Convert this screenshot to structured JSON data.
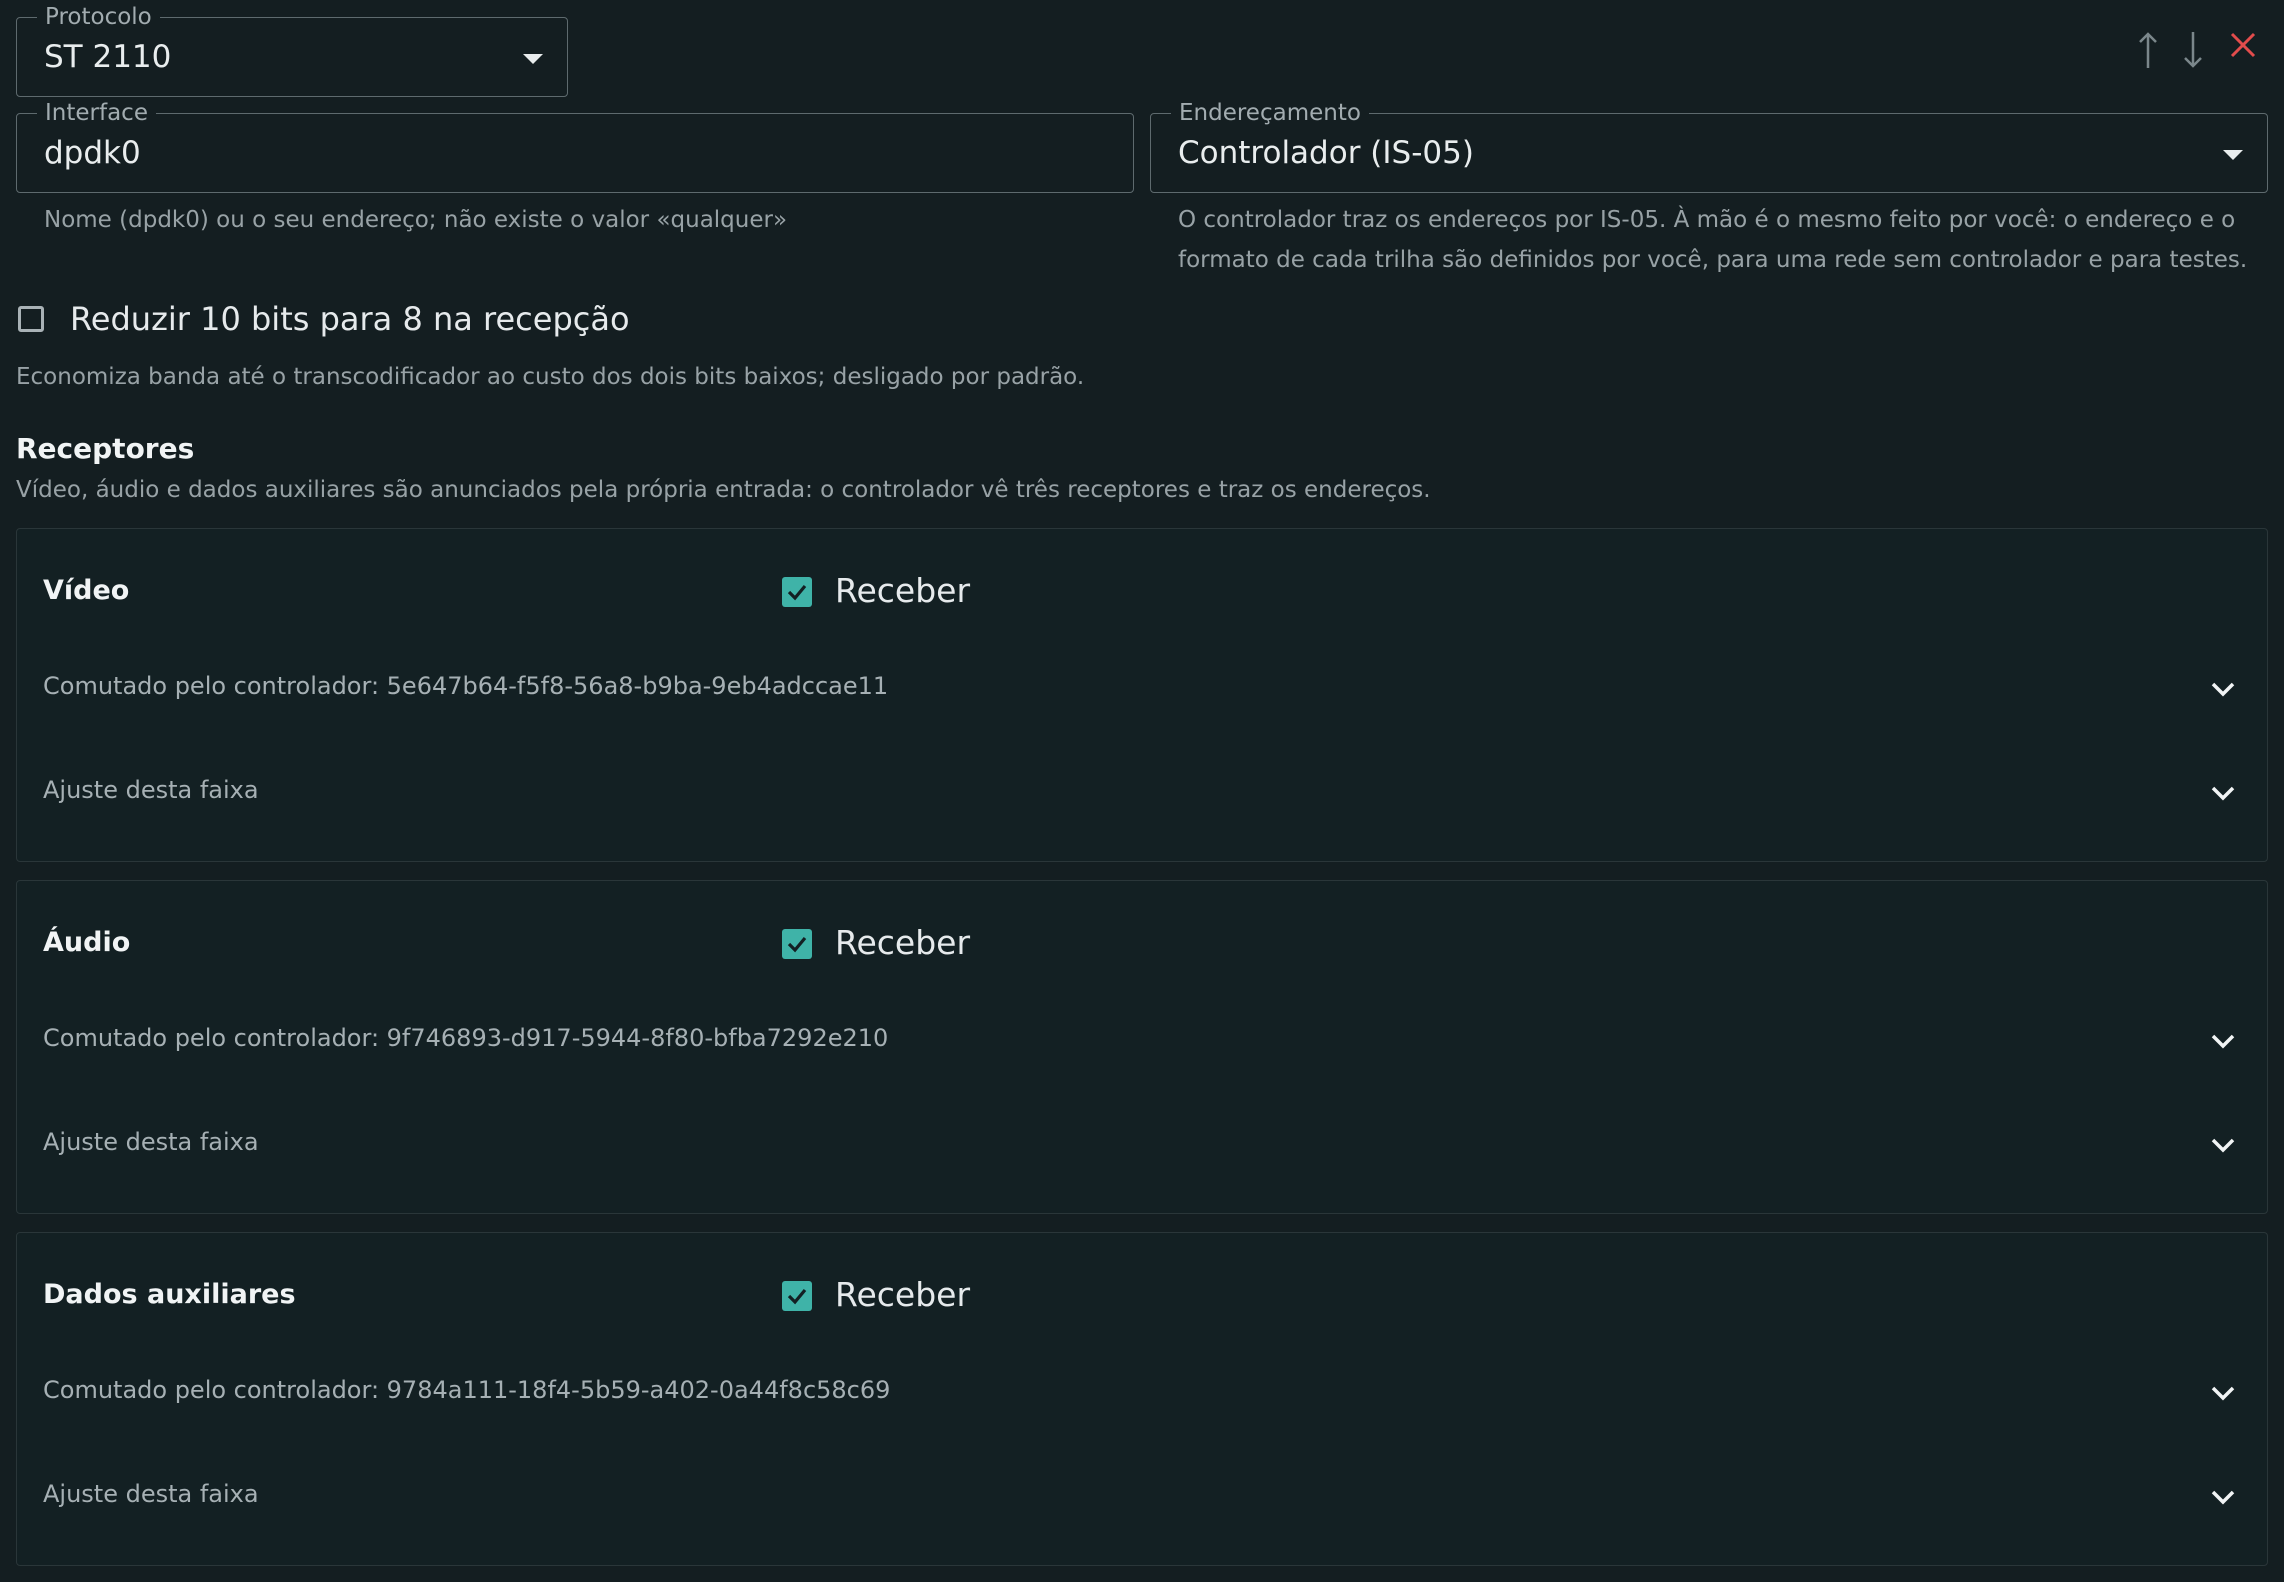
{
  "protocol": {
    "label": "Protocolo",
    "value": "ST 2110"
  },
  "window_controls": {
    "move_up": "↑",
    "move_down": "↓"
  },
  "interface": {
    "label": "Interface",
    "value": "dpdk0",
    "helper": "Nome (dpdk0) ou o seu endereço; não existe o valor «qualquer»"
  },
  "addressing": {
    "label": "Endereçamento",
    "value": "Controlador (IS-05)",
    "helper_line1": "O controlador traz os endereços por IS-05. À mão é o mesmo feito por você: o endereço e o",
    "helper_line2": "formato de cada trilha são definidos por você, para uma rede sem controlador e para testes."
  },
  "reduce_bits": {
    "label": "Reduzir 10 bits para 8 na recepção",
    "checked": false,
    "helper": "Economiza banda até o transcodificador ao custo dos dois bits baixos; desligado por padrão."
  },
  "receivers": {
    "title": "Receptores",
    "description": "Vídeo, áudio e dados auxiliares são anunciados pela própria entrada: o controlador vê três receptores e traz os endereços.",
    "cards": [
      {
        "name": "Vídeo",
        "receive_label": "Receber",
        "receive_checked": true,
        "switched": "Comutado pelo controlador: 5e647b64-f5f8-56a8-b9ba-9eb4adccae11",
        "adjust": "Ajuste desta faixa"
      },
      {
        "name": "Áudio",
        "receive_label": "Receber",
        "receive_checked": true,
        "switched": "Comutado pelo controlador: 9f746893-d917-5944-8f80-bfba7292e210",
        "adjust": "Ajuste desta faixa"
      },
      {
        "name": "Dados auxiliares",
        "receive_label": "Receber",
        "receive_checked": true,
        "switched": "Comutado pelo controlador: 9784a111-18f4-5b59-a402-0a44f8c58c69",
        "adjust": "Ajuste desta faixa"
      }
    ]
  },
  "colors": {
    "background": "#141e21",
    "accent": "#3fb3a8",
    "close": "#e34c4c"
  }
}
